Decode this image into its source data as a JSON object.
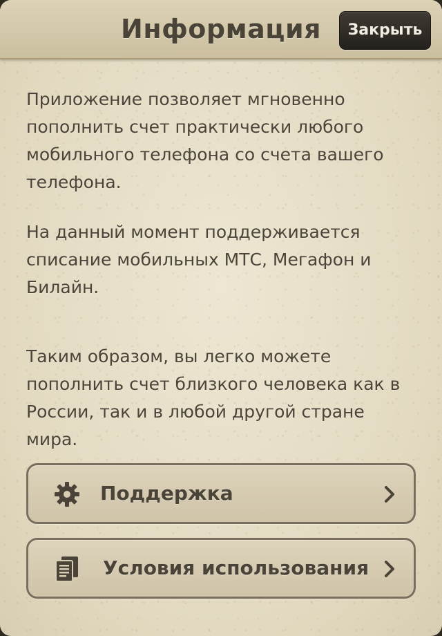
{
  "header": {
    "title": "Информация",
    "close_label": "Закрыть"
  },
  "content": {
    "paragraphs": [
      "Приложение позволяет мгновенно пополнить счет практически любого мобильного телефона со счета вашего телефона.",
      "На данный момент поддерживается списание мобильных МТС, Мегафон и Билайн.",
      "Таким образом, вы легко можете пополнить счет близкого человека как в России, так и в любой другой стране мира."
    ]
  },
  "menu": {
    "items": [
      {
        "label": "Поддержка",
        "icon": "gear-icon"
      },
      {
        "label": "Условия использования",
        "icon": "document-icon"
      }
    ]
  },
  "colors": {
    "background": "#e7dfc9",
    "text": "#4a4538",
    "close_button": "#2f2b26",
    "border": "#7a6f5d"
  }
}
